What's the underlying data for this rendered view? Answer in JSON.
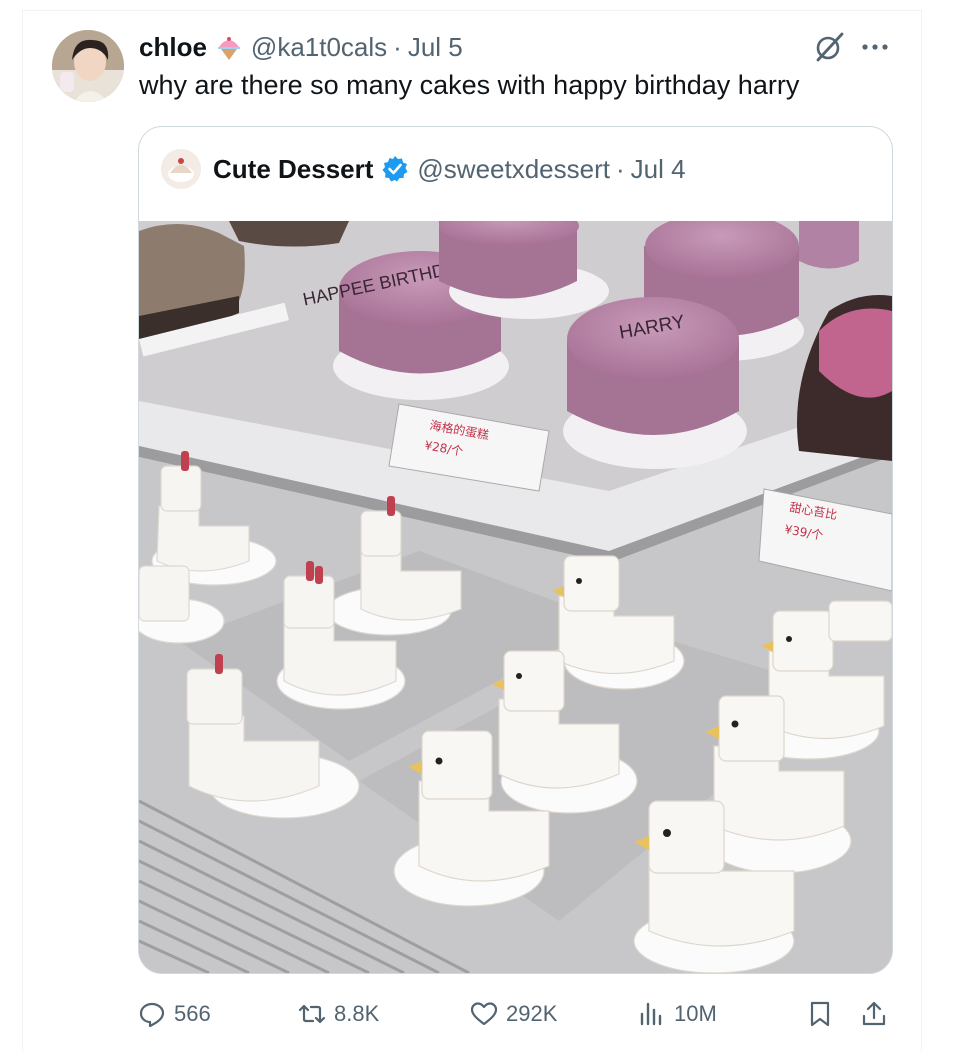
{
  "tweet": {
    "author_name": "chloe",
    "author_handle": "@ka1t0cals",
    "separator": "·",
    "date": "Jul 5",
    "text": "why are there so many cakes with happy birthday harry"
  },
  "quote": {
    "author_name": "Cute Dessert",
    "author_handle": "@sweetxdessert",
    "separator": "·",
    "date": "Jul 4",
    "image_text": {
      "cake_writing": "HAPPEE BIRTHDAE HARRY",
      "price_tag_left_title": "海格的蛋糕",
      "price_tag_left_price": "¥28/个",
      "price_tag_right_title": "甜心苔比",
      "price_tag_right_price": "¥39/个"
    }
  },
  "actions": {
    "replies": "566",
    "reposts": "8.8K",
    "likes": "292K",
    "views": "10M"
  },
  "colors": {
    "text_primary": "#0f1419",
    "text_secondary": "#536471",
    "border": "#cfd9de",
    "verified": "#1d9bf0",
    "cake_pink": "#b97fa6"
  },
  "icons": [
    "grok-icon",
    "more-icon",
    "verified-icon",
    "reply-icon",
    "repost-icon",
    "like-icon",
    "views-icon",
    "bookmark-icon",
    "share-icon"
  ]
}
